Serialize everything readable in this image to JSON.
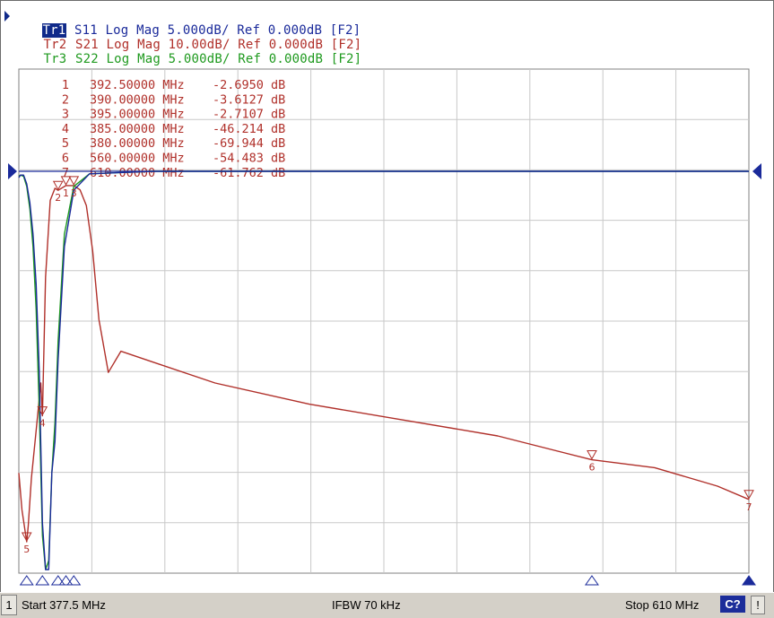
{
  "traces": [
    {
      "label": "Tr1",
      "desc": " S11 Log Mag 5.000dB/ Ref 0.000dB [F2]",
      "color": "#1a2a9a",
      "active": true
    },
    {
      "label": "Tr2",
      "desc": " S21 Log Mag 10.00dB/ Ref 0.000dB [F2]",
      "color": "#b0302a",
      "active": false
    },
    {
      "label": "Tr3",
      "desc": " S22 Log Mag 5.000dB/ Ref 0.000dB [F2]",
      "color": "#1f9a1f",
      "active": false
    }
  ],
  "marker_table": [
    {
      "num": "1",
      "freq": "392.50000 MHz",
      "val": "-2.6950 dB"
    },
    {
      "num": "2",
      "freq": "390.00000 MHz",
      "val": "-3.6127 dB"
    },
    {
      "num": "3",
      "freq": "395.00000 MHz",
      "val": "-2.7107 dB"
    },
    {
      "num": "4",
      "freq": "385.00000 MHz",
      "val": "-46.214 dB"
    },
    {
      "num": "5",
      "freq": "380.00000 MHz",
      "val": "-69.944 dB"
    },
    {
      "num": "6",
      "freq": "560.00000 MHz",
      "val": "-54.483 dB"
    },
    {
      "num": "7",
      "freq": "610.00000 MHz",
      "val": "-61.762 dB"
    }
  ],
  "chart_data": {
    "type": "line",
    "x_start_mhz": 377.5,
    "x_stop_mhz": 610,
    "grid": true,
    "grid_divisions": {
      "x": 10,
      "y": 10
    },
    "series": [
      {
        "name": "Tr1",
        "color": "#1a2a9a",
        "x": [
          377.5,
          378,
          379,
          380,
          381,
          382,
          383,
          384,
          385,
          386,
          387,
          388,
          389,
          390,
          392,
          395,
          400,
          420,
          450,
          500,
          560,
          610
        ],
        "y": [
          -0.5,
          -0.3,
          -0.3,
          -1.0,
          -2.5,
          -5.0,
          -9.0,
          -16.0,
          -28.0,
          -35.0,
          -39.0,
          -24.0,
          -21.5,
          -15.0,
          -6.0,
          -1.5,
          -0.2,
          0,
          0,
          0,
          0,
          0
        ]
      },
      {
        "name": "Tr2",
        "color": "#b0302a",
        "x": [
          377.5,
          378.5,
          379.5,
          380,
          380.5,
          381.5,
          383,
          384.5,
          385,
          386,
          387.5,
          389,
          390,
          392.5,
          395,
          397,
          399,
          401,
          403,
          406,
          410,
          420,
          440,
          470,
          500,
          530,
          560,
          580,
          600,
          610
        ],
        "y": [
          -57,
          -64,
          -68,
          -70,
          -67,
          -58,
          -49,
          -40,
          -46.2,
          -20,
          -5.5,
          -3.2,
          -3.6,
          -2.7,
          -2.7,
          -3.5,
          -6.5,
          -15,
          -28,
          -38,
          -34,
          -36,
          -40,
          -44,
          -47,
          -50,
          -54.5,
          -56,
          -59.5,
          -62
        ]
      },
      {
        "name": "Tr3",
        "color": "#1f9a1f",
        "x": [
          377.5,
          378,
          379,
          380,
          381,
          382,
          383,
          384,
          385,
          386,
          387,
          388,
          389,
          390,
          392,
          395,
          400,
          420,
          450,
          500,
          560,
          610
        ],
        "y": [
          -0.4,
          -0.3,
          -0.4,
          -1.2,
          -3.0,
          -6.0,
          -11.0,
          -19.0,
          -29.0,
          -32.0,
          -31.0,
          -24.0,
          -20.0,
          -13.5,
          -5.0,
          -1.2,
          -0.2,
          0,
          0,
          0,
          0,
          0
        ]
      }
    ],
    "markers": [
      {
        "num": "1",
        "freq_mhz": 392.5,
        "trace": "Tr2"
      },
      {
        "num": "2",
        "freq_mhz": 390,
        "trace": "Tr2"
      },
      {
        "num": "3",
        "freq_mhz": 395,
        "trace": "Tr2"
      },
      {
        "num": "4",
        "freq_mhz": 385,
        "trace": "Tr2"
      },
      {
        "num": "5",
        "freq_mhz": 380,
        "trace": "Tr2"
      },
      {
        "num": "6",
        "freq_mhz": 560,
        "trace": "Tr2"
      },
      {
        "num": "7",
        "freq_mhz": 610,
        "trace": "Tr2"
      }
    ]
  },
  "status_bar": {
    "channel": "1",
    "start": "Start 377.5 MHz",
    "ifbw": "IFBW 70 kHz",
    "stop": "Stop 610 MHz",
    "cal_badge": "C?",
    "warn": "!"
  }
}
